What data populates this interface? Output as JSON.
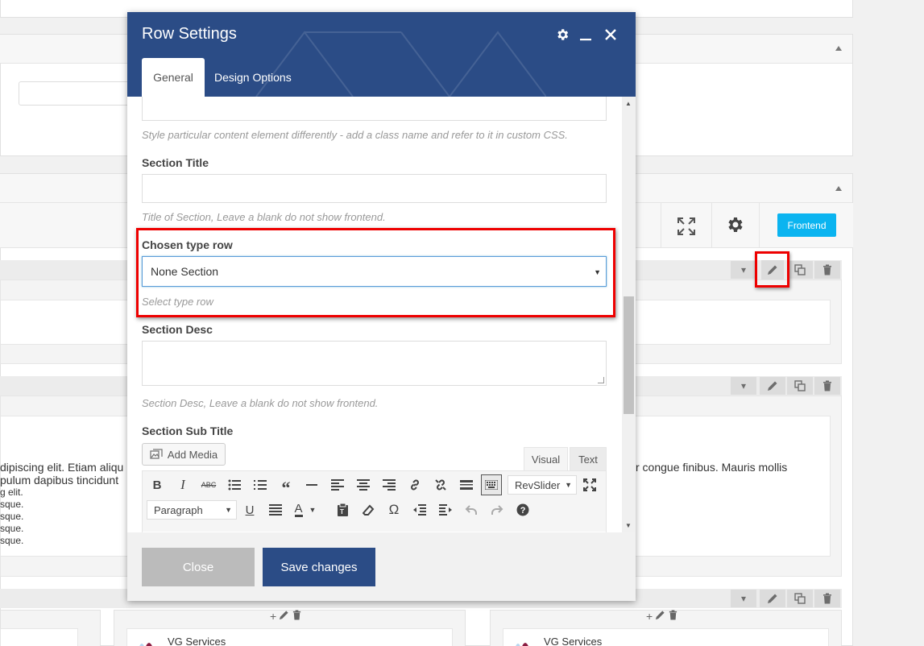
{
  "modal": {
    "title": "Row Settings",
    "tabs": [
      {
        "label": "General",
        "active": true
      },
      {
        "label": "Design Options",
        "active": false
      }
    ],
    "header_color": "#2b4c86"
  },
  "fields": {
    "css_class_desc": "Style particular content element differently - add a class name and refer to it in custom CSS.",
    "section_title_label": "Section Title",
    "section_title_value": "",
    "section_title_desc": "Title of Section, Leave a blank do not show frontend.",
    "chosen_type_label": "Chosen type row",
    "chosen_type_value": "None Section",
    "chosen_type_desc": "Select type row",
    "section_desc_label": "Section Desc",
    "section_desc_value": "",
    "section_desc_desc": "Section Desc, Leave a blank do not show frontend.",
    "section_subtitle_label": "Section Sub Title"
  },
  "editor": {
    "add_media": "Add Media",
    "tab_visual": "Visual",
    "tab_text": "Text",
    "revslider": "RevSlider",
    "paragraph": "Paragraph",
    "toolbar_row1": [
      "bold-icon",
      "italic-icon",
      "strikethrough-icon",
      "bullet-list-icon",
      "numbered-list-icon",
      "blockquote-icon",
      "horizontal-rule-icon",
      "align-left-icon",
      "align-center-icon",
      "align-right-icon",
      "link-icon",
      "unlink-icon",
      "read-more-icon",
      "toolbar-toggle-icon",
      "fullscreen-icon"
    ],
    "toolbar_row2": [
      "underline-icon",
      "justify-icon",
      "text-color-icon",
      "paste-text-icon",
      "clear-formatting-icon",
      "special-char-icon",
      "outdent-icon",
      "indent-icon",
      "undo-icon",
      "redo-icon",
      "help-icon"
    ]
  },
  "footer": {
    "close_label": "Close",
    "save_label": "Save changes"
  },
  "background": {
    "frontend_label": "Frontend",
    "frontend_color": "#0bb4f0",
    "lorem_left": [
      "dipiscing elit. Etiam aliqu",
      "pulum dapibus tincidunt",
      "g elit.",
      "sque.",
      "sque.",
      "sque.",
      "sque."
    ],
    "lorem_right": "r congue finibus. Mauris mollis",
    "element_title": "VG Services"
  },
  "highlight_color": "#e00000"
}
